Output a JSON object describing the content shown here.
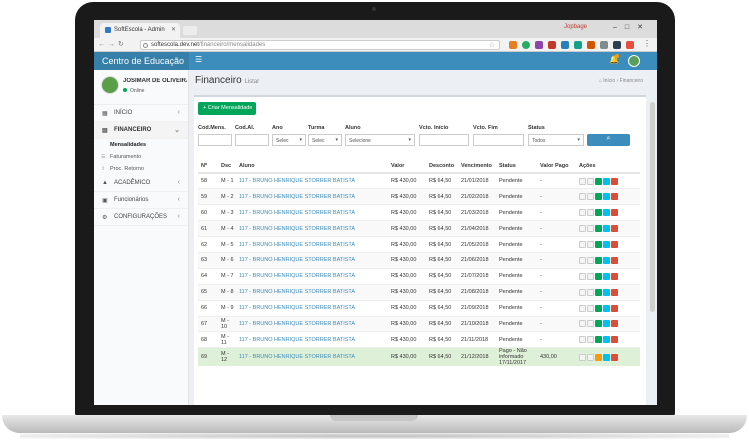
{
  "browser": {
    "tab_title": "SoftEscola - Admin",
    "url_host": "softescola.dev.net",
    "url_path": "/financeiro/mensalidades",
    "user_badge": "Jopbage"
  },
  "app": {
    "brand": "Centro de Educação",
    "user_name": "JOSIMAR DE OLIVEIRA FARIA",
    "user_status": "Online"
  },
  "sidebar": {
    "items": [
      {
        "label": "INÍCIO",
        "icon": "dashboard-icon"
      },
      {
        "label": "FINANCEIRO",
        "icon": "money-icon"
      },
      {
        "label": "ACADÊMICO",
        "icon": "graduation-cap-icon"
      },
      {
        "label": "Funcionários",
        "icon": "briefcase-icon"
      },
      {
        "label": "CONFIGURAÇÕES",
        "icon": "cogs-icon"
      }
    ],
    "sub_items": [
      "Mensalidades",
      "Faturamento",
      "Proc. Retorno"
    ]
  },
  "page": {
    "title": "Financeiro",
    "subtitle": "Listar",
    "breadcrumb_home": "Início",
    "breadcrumb_current": "Financeiro",
    "create_button": "+ Criar Mensalidade"
  },
  "filters": {
    "labels": [
      "Cod.Mens.",
      "Cod.Al.",
      "Ano",
      "Turma",
      "Aluno",
      "Vcto. Início",
      "Vcto. Fim",
      "Status"
    ],
    "ano_value": "Selec",
    "turma_value": "Selec",
    "aluno_value": "Selecione",
    "status_value": "Todos"
  },
  "table": {
    "headers": [
      "Nº",
      "Dsc",
      "Aluno",
      "Valor",
      "Desconto",
      "Vencimento",
      "Status",
      "Valor Pago",
      "Ações"
    ],
    "rows": [
      {
        "n": "58",
        "dsc": "M - 1",
        "aluno": "117 - BRUNO HENRIQUE STORRER BATISTA",
        "valor": "R$ 430,00",
        "desconto": "R$ 64,50",
        "venc": "21/01/2018",
        "status": "Pendente",
        "pago": "-"
      },
      {
        "n": "59",
        "dsc": "M - 2",
        "aluno": "117 - BRUNO HENRIQUE STORRER BATISTA",
        "valor": "R$ 430,00",
        "desconto": "R$ 64,50",
        "venc": "21/02/2018",
        "status": "Pendente",
        "pago": "-"
      },
      {
        "n": "60",
        "dsc": "M - 3",
        "aluno": "117 - BRUNO HENRIQUE STORRER BATISTA",
        "valor": "R$ 430,00",
        "desconto": "R$ 64,50",
        "venc": "21/03/2018",
        "status": "Pendente",
        "pago": "-"
      },
      {
        "n": "61",
        "dsc": "M - 4",
        "aluno": "117 - BRUNO HENRIQUE STORRER BATISTA",
        "valor": "R$ 430,00",
        "desconto": "R$ 64,50",
        "venc": "21/04/2018",
        "status": "Pendente",
        "pago": "-"
      },
      {
        "n": "62",
        "dsc": "M - 5",
        "aluno": "117 - BRUNO HENRIQUE STORRER BATISTA",
        "valor": "R$ 430,00",
        "desconto": "R$ 64,50",
        "venc": "21/05/2018",
        "status": "Pendente",
        "pago": "-"
      },
      {
        "n": "63",
        "dsc": "M - 6",
        "aluno": "117 - BRUNO HENRIQUE STORRER BATISTA",
        "valor": "R$ 430,00",
        "desconto": "R$ 64,50",
        "venc": "21/06/2018",
        "status": "Pendente",
        "pago": "-"
      },
      {
        "n": "64",
        "dsc": "M - 7",
        "aluno": "117 - BRUNO HENRIQUE STORRER BATISTA",
        "valor": "R$ 430,00",
        "desconto": "R$ 64,50",
        "venc": "21/07/2018",
        "status": "Pendente",
        "pago": "-"
      },
      {
        "n": "65",
        "dsc": "M - 8",
        "aluno": "117 - BRUNO HENRIQUE STORRER BATISTA",
        "valor": "R$ 430,00",
        "desconto": "R$ 64,50",
        "venc": "21/08/2018",
        "status": "Pendente",
        "pago": "-"
      },
      {
        "n": "66",
        "dsc": "M - 9",
        "aluno": "117 - BRUNO HENRIQUE STORRER BATISTA",
        "valor": "R$ 430,00",
        "desconto": "R$ 64,50",
        "venc": "21/09/2018",
        "status": "Pendente",
        "pago": "-"
      },
      {
        "n": "67",
        "dsc": "M - 10",
        "aluno": "117 - BRUNO HENRIQUE STORRER BATISTA",
        "valor": "R$ 430,00",
        "desconto": "R$ 64,50",
        "venc": "21/10/2018",
        "status": "Pendente",
        "pago": "-"
      },
      {
        "n": "68",
        "dsc": "M - 11",
        "aluno": "117 - BRUNO HENRIQUE STORRER BATISTA",
        "valor": "R$ 430,00",
        "desconto": "R$ 64,50",
        "venc": "21/11/2018",
        "status": "Pendente",
        "pago": "-"
      },
      {
        "n": "69",
        "dsc": "M - 12",
        "aluno": "117 - BRUNO HENRIQUE STORRER BATISTA",
        "valor": "R$ 430,00",
        "desconto": "R$ 64,50",
        "venc": "21/12/2018",
        "status": "Pago - Não informado 17/11/2017",
        "pago": "430,00"
      }
    ]
  },
  "colors": {
    "header": "#3c8dbc",
    "brand_bg": "#367fa9",
    "create": "#00a65a",
    "paid_row": "#dff0d8"
  }
}
